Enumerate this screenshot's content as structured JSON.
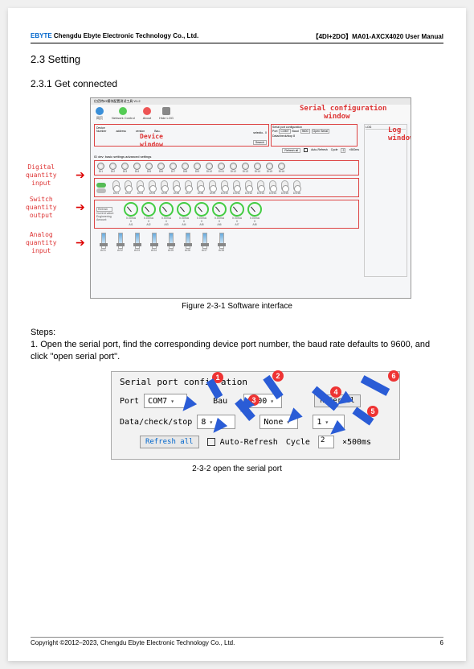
{
  "header": {
    "logo": "EBYTE",
    "company": "Chengdu Ebyte Electronic Technology Co., Ltd.",
    "doc": "【4DI+2DO】MA01-AXCX4020 User Manual"
  },
  "sec": {
    "h2": "2.3 Setting",
    "h3": "2.3.1 Get connected"
  },
  "fig1": {
    "title": "亿佰特IO模块配置测试工具 V1.2",
    "tools": [
      "网页",
      "Network Control",
      "About",
      "Hide LOG"
    ],
    "red": {
      "serial1": "Serial configuration",
      "serial2": "window",
      "device1": "Device",
      "device2": "window",
      "log": "Log window"
    },
    "devbox": {
      "labels": [
        "Device",
        "Number",
        "address",
        "version",
        "Bau.."
      ],
      "select": "selectio.. 0",
      "search": "Search"
    },
    "serbox": {
      "title": "Serial port configuration",
      "port": "Port",
      "portv": "COM7",
      "baud": "Baud",
      "baudv": "9600",
      "open": "Open Serial",
      "dcs": "Data/check/stop 8"
    },
    "logbox": {
      "title": "LOG"
    },
    "refresh": {
      "all": "Refresh all",
      "auto": "Auto-Refresh",
      "cycle": "Cycle",
      "cyclev": "2",
      "unit": "×500ms"
    },
    "tabs": "ID dev: basic settings advanced settings",
    "di_labels": [
      "DI1",
      "DI2",
      "DI3",
      "DI4",
      "DI5",
      "DI6",
      "DI7",
      "DI8",
      "DI9",
      "DI10",
      "DI11",
      "DI12",
      "DI13",
      "DI14",
      "DI15",
      "DI16"
    ],
    "do": {
      "allon": "All ON",
      "alloff": "All OFF"
    },
    "do_labels": [
      "DO1",
      "DO2",
      "DO3",
      "DO4",
      "DO5",
      "DO6",
      "DO7",
      "DO8",
      "DO9",
      "DO10",
      "DO11",
      "DO12",
      "DO13",
      "DO14",
      "DO15",
      "DO16"
    ],
    "ai": {
      "refresh": "Refresh",
      "curr": "Current value:",
      "eng": "Engineering Amount:",
      "vals": [
        "0.00mA",
        "0.00mA",
        "0.00mA",
        "0.00mA",
        "0.00mA",
        "0.00mA",
        "0.00mA",
        "0.00mA"
      ],
      "zeros": [
        "0",
        "0",
        "0",
        "0",
        "0",
        "0",
        "0",
        "0"
      ],
      "labels": [
        "AI1",
        "AI2",
        "AI3",
        "AI4",
        "AI5",
        "AI6",
        "AI7",
        "AI8"
      ]
    },
    "ao_labels": [
      "AO1",
      "AO2",
      "AO3",
      "AO4",
      "AO5",
      "AO6",
      "AO7",
      "AO8"
    ],
    "caption": "Figure 2-3-1 Software interface"
  },
  "anno": {
    "di": "Digital\nquantity\ninput",
    "do": "Switch\nquantity\noutput",
    "ai": "Analog\nquantity\ninput"
  },
  "steps": {
    "title": "Steps:",
    "s1": "1.  Open the serial port, find the corresponding device port number, the baud rate defaults to 9600, and click \"open serial port\"."
  },
  "fig2": {
    "title": "Serial port confi",
    "title2": "ation",
    "port": "Port",
    "portv": "COM7",
    "baud": "Bau",
    "baud2": "",
    "baudv": "9600",
    "open": "n Serial",
    "dcs": "Data/check/stop",
    "dcsv": "8",
    "parity": "None",
    "stop": "1",
    "refresh": "Refresh all",
    "auto": "Auto-Refresh",
    "cycle": "Cycle",
    "cyclev": "2",
    "unit": "×500ms",
    "caption": "2-3-2 open the serial port"
  },
  "footer": {
    "copy": "Copyright ©2012–2023, Chengdu Ebyte Electronic Technology Co., Ltd.",
    "page": "6"
  }
}
